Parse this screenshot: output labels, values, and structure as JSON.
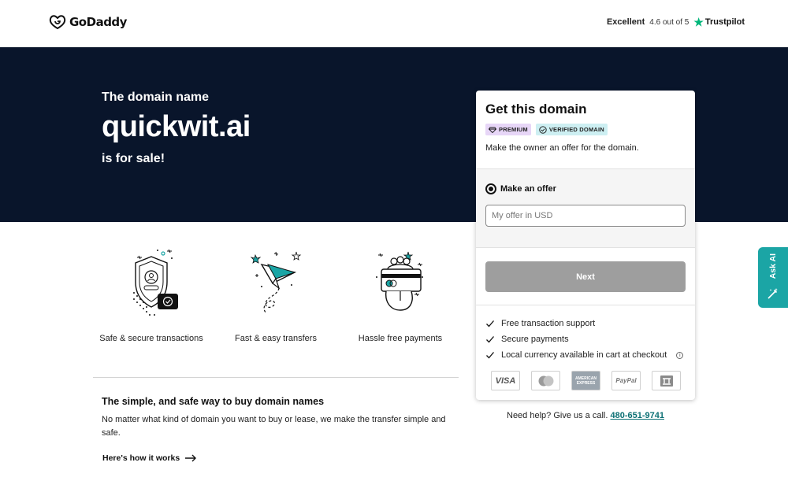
{
  "header": {
    "logo_text": "GoDaddy",
    "rating_word": "Excellent",
    "rating_score": "4.6 out of 5",
    "rating_brand": "Trustpilot"
  },
  "hero": {
    "pre_text": "The domain name",
    "domain": "quickwit.ai",
    "post_text": "is for sale!"
  },
  "features": [
    {
      "label": "Safe & secure transactions",
      "icon": "shield-icon"
    },
    {
      "label": "Fast & easy transfers",
      "icon": "paper-plane-icon"
    },
    {
      "label": "Hassle free payments",
      "icon": "payment-card-icon"
    }
  ],
  "info": {
    "title": "The simple, and safe way to buy domain names",
    "text": "No matter what kind of domain you want to buy or lease, we make the transfer simple and safe.",
    "link": "Here's how it works"
  },
  "card": {
    "title": "Get this domain",
    "badges": {
      "premium": "PREMIUM",
      "verified": "VERIFIED DOMAIN"
    },
    "subtitle": "Make the owner an offer for the domain.",
    "offer_label": "Make an offer",
    "offer_placeholder": "My offer in USD",
    "next_label": "Next",
    "benefits": [
      "Free transaction support",
      "Secure payments",
      "Local currency available in cart at checkout"
    ],
    "payments": [
      "VISA",
      "mastercard",
      "AMERICAN EXPRESS",
      "PayPal",
      "bank"
    ]
  },
  "help": {
    "text": "Need help? Give us a call.",
    "phone": "480-651-9741"
  },
  "ask_ai": {
    "label": "Ask AI"
  },
  "colors": {
    "hero_bg": "#09152b",
    "teal": "#1ba5a5",
    "button_disabled": "#9e9e9e",
    "premium_badge": "#e7d6f7",
    "verified_badge": "#cdeff2",
    "trustpilot_star": "#00b67a"
  }
}
